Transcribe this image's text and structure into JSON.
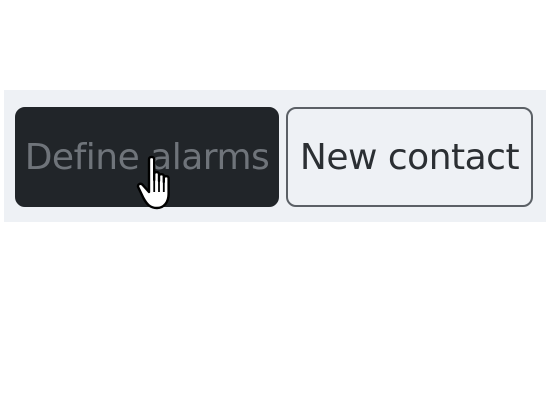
{
  "toolbar": {
    "define_alarms_label": "Define alarms",
    "new_contact_label": "New contact"
  },
  "icons": {
    "cursor": "hand-pointer-icon"
  },
  "colors": {
    "dark_button_bg": "#212529",
    "dark_button_text": "#6f747a",
    "light_button_bg": "#eef1f5",
    "light_button_border": "#5b6066",
    "toolbar_bg": "#eef1f5"
  }
}
